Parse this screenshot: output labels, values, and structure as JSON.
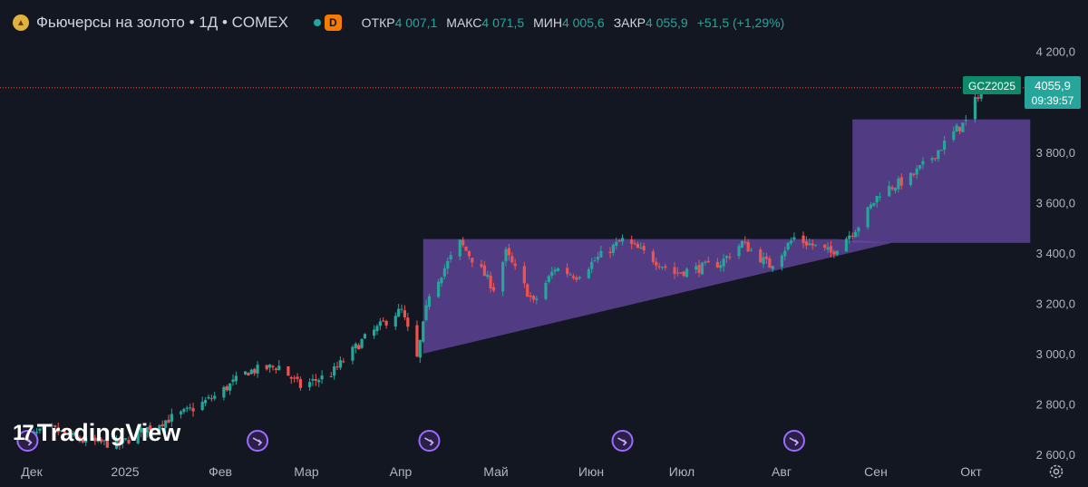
{
  "header": {
    "title": "Фьючерсы на золото • 1Д • COMEX",
    "status_badge": "D",
    "open_label": "ОТКР",
    "open_value": "4 007,1",
    "high_label": "МАКС",
    "high_value": "4 071,5",
    "low_label": "МИН",
    "low_value": "4 005,6",
    "close_label": "ЗАКР",
    "close_value": "4 055,9",
    "change": "+51,5 (+1,29%)"
  },
  "price_label": {
    "symbol": "GCZ2025",
    "price": "4055,9",
    "countdown": "09:39:57"
  },
  "branding": {
    "logo_text": "TradingView"
  },
  "colors": {
    "up": "#26a69a",
    "down": "#ef5350",
    "pattern": "#6a4aa8",
    "background": "#131722"
  },
  "chart_data": {
    "type": "candlestick",
    "x_axis_labels": [
      "Дек",
      "2025",
      "Фев",
      "Мар",
      "Апр",
      "Май",
      "Июн",
      "Июл",
      "Авг",
      "Сен",
      "Окт"
    ],
    "y_ticks": [
      2600,
      2800,
      3000,
      3200,
      3400,
      3600,
      3800,
      4200
    ],
    "y_tick_labels": [
      "2 600,0",
      "2 800,0",
      "3 000,0",
      "3 200,0",
      "3 400,0",
      "3 600,0",
      "3 800,0",
      "4 200,0"
    ],
    "ylim": [
      2575,
      4260
    ],
    "last_price": 4055.9,
    "grid": false,
    "anchors": [
      [
        "2024-11-28",
        2660
      ],
      [
        "2024-12-09",
        2700
      ],
      [
        "2024-12-20",
        2650
      ],
      [
        "2024-12-31",
        2640
      ],
      [
        "2025-01-10",
        2710
      ],
      [
        "2025-01-22",
        2770
      ],
      [
        "2025-01-31",
        2830
      ],
      [
        "2025-02-11",
        2930
      ],
      [
        "2025-02-21",
        2950
      ],
      [
        "2025-02-28",
        2870
      ],
      [
        "2025-03-10",
        2920
      ],
      [
        "2025-03-20",
        3050
      ],
      [
        "2025-03-31",
        3160
      ],
      [
        "2025-04-02",
        3170
      ],
      [
        "2025-04-07",
        2980
      ],
      [
        "2025-04-11",
        3240
      ],
      [
        "2025-04-21",
        3440
      ],
      [
        "2025-04-28",
        3330
      ],
      [
        "2025-05-02",
        3260
      ],
      [
        "2025-05-06",
        3400
      ],
      [
        "2025-05-15",
        3200
      ],
      [
        "2025-05-22",
        3340
      ],
      [
        "2025-05-29",
        3310
      ],
      [
        "2025-06-05",
        3380
      ],
      [
        "2025-06-13",
        3450
      ],
      [
        "2025-06-20",
        3400
      ],
      [
        "2025-06-30",
        3320
      ],
      [
        "2025-07-08",
        3340
      ],
      [
        "2025-07-15",
        3360
      ],
      [
        "2025-07-22",
        3440
      ],
      [
        "2025-07-31",
        3350
      ],
      [
        "2025-08-08",
        3460
      ],
      [
        "2025-08-20",
        3400
      ],
      [
        "2025-08-29",
        3510
      ],
      [
        "2025-09-05",
        3640
      ],
      [
        "2025-09-15",
        3700
      ],
      [
        "2025-09-22",
        3780
      ],
      [
        "2025-09-30",
        3890
      ],
      [
        "2025-10-03",
        3920
      ],
      [
        "2025-10-08",
        4055.9
      ]
    ],
    "overlays": {
      "triangle": [
        [
          "2025-04-09",
          3000
        ],
        [
          "2025-04-09",
          3455
        ],
        [
          "2025-08-22",
          3455
        ]
      ],
      "triangle_support_end": [
        "2025-09-09",
        3440
      ],
      "channel_box": {
        "x": [
          "2025-08-27",
          "2025-10-24"
        ],
        "y": [
          3440,
          3930
        ]
      }
    },
    "event_markers": [
      "2024-12-01",
      "2025-02-14",
      "2025-04-11",
      "2025-06-13",
      "2025-08-08"
    ]
  }
}
